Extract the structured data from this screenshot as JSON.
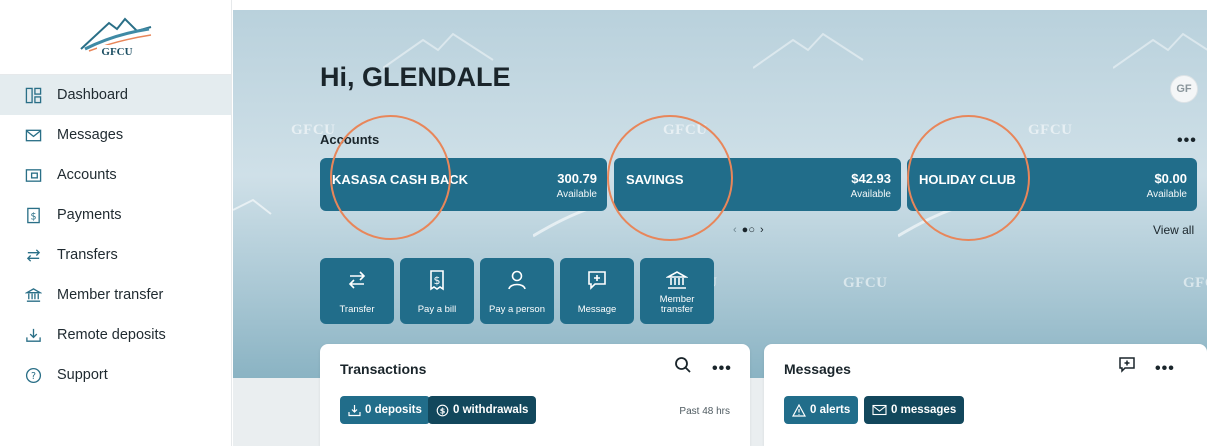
{
  "sidebar": {
    "logo_text": "GFCU",
    "items": [
      {
        "label": "Dashboard",
        "icon": "dashboard-icon",
        "active": true
      },
      {
        "label": "Messages",
        "icon": "envelope-icon"
      },
      {
        "label": "Accounts",
        "icon": "accounts-icon"
      },
      {
        "label": "Payments",
        "icon": "payments-icon"
      },
      {
        "label": "Transfers",
        "icon": "transfers-icon"
      },
      {
        "label": "Member transfer",
        "icon": "bank-icon"
      },
      {
        "label": "Remote deposits",
        "icon": "deposit-icon"
      },
      {
        "label": "Support",
        "icon": "help-icon"
      }
    ]
  },
  "header": {
    "greeting": "Hi, GLENDALE",
    "avatar_initials": "GF"
  },
  "watermark": "GFCU",
  "accounts": {
    "title": "Accounts",
    "more": "•••",
    "cards": [
      {
        "name": "KASASA CASH BACK",
        "balance": "300.79",
        "status": "Available"
      },
      {
        "name": "SAVINGS",
        "balance": "$42.93",
        "status": "Available"
      },
      {
        "name": "HOLIDAY CLUB",
        "balance": "$0.00",
        "status": "Available"
      }
    ],
    "pager": {
      "prev": "‹",
      "dots": "●○",
      "next": "›"
    },
    "view_all": "View all"
  },
  "quick_actions": [
    {
      "label": "Transfer",
      "icon": "transfer-icon"
    },
    {
      "label": "Pay a bill",
      "icon": "bill-icon"
    },
    {
      "label": "Pay a person",
      "icon": "person-icon"
    },
    {
      "label": "Message",
      "icon": "message-plus-icon"
    },
    {
      "label": "Member\ntransfer",
      "icon": "bank-icon"
    }
  ],
  "transactions": {
    "title": "Transactions",
    "more": "•••",
    "deposits": "0 deposits",
    "withdrawals": "0 withdrawals",
    "period": "Past 48 hrs"
  },
  "messages_card": {
    "title": "Messages",
    "more": "•••",
    "alerts": "0 alerts",
    "messages": "0 messages"
  },
  "colors": {
    "accent": "#216d8a",
    "accent_dark": "#12475c",
    "highlight_circle": "#e8865a"
  }
}
